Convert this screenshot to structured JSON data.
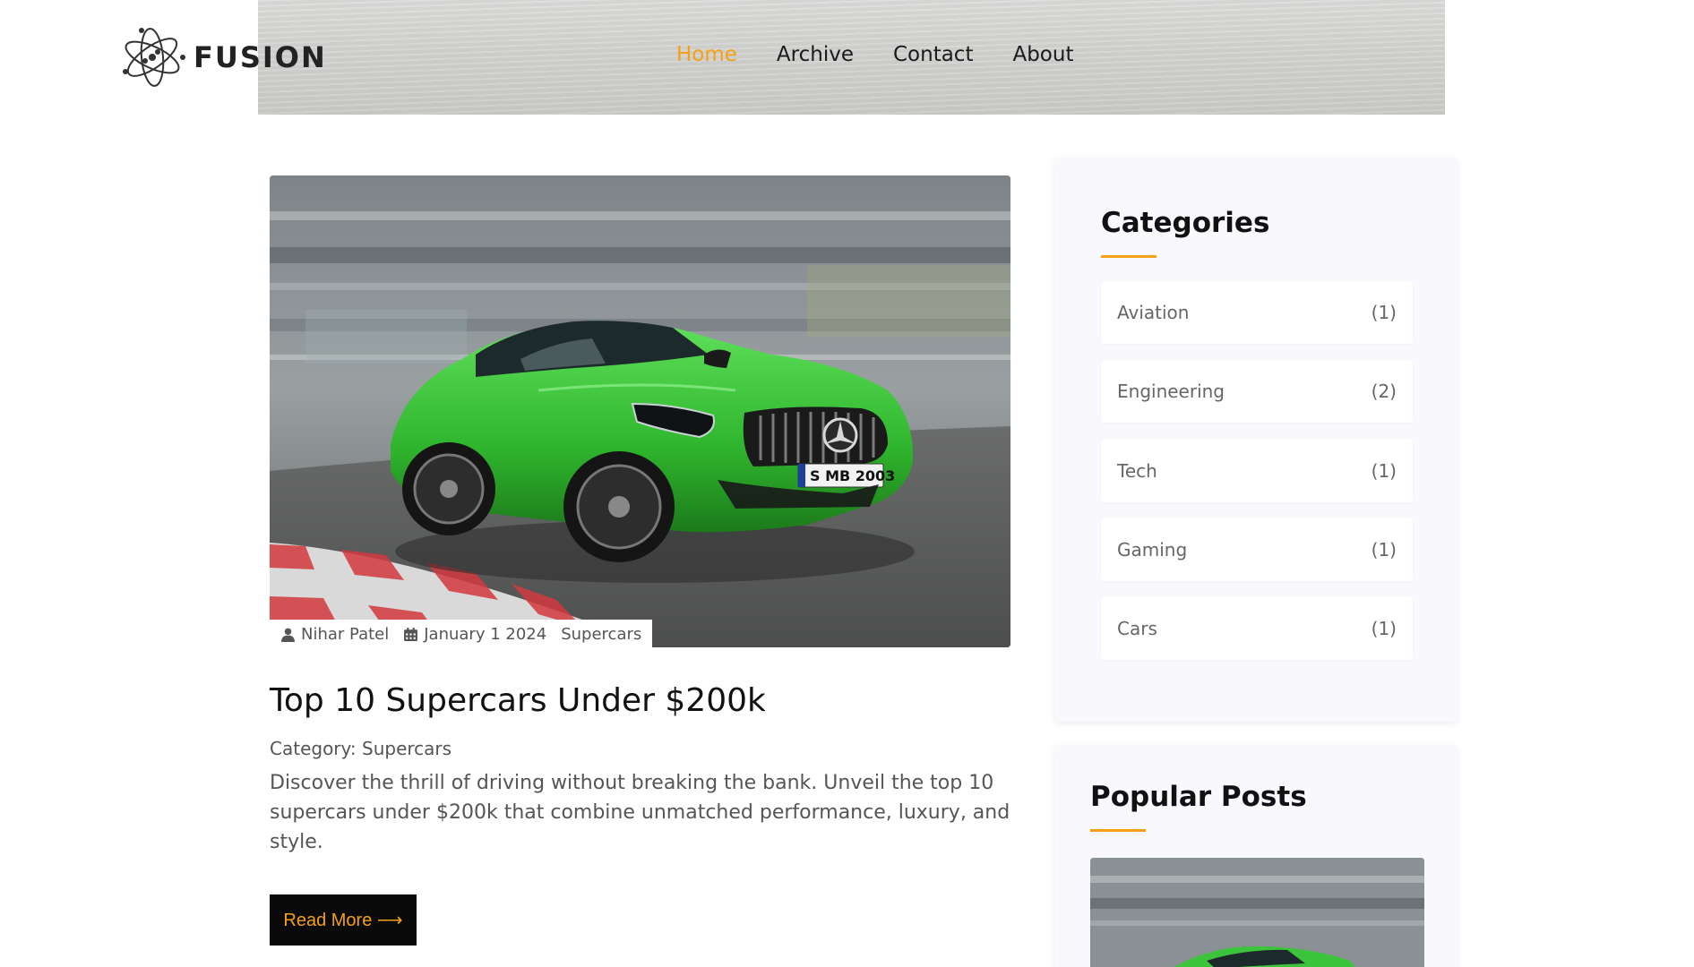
{
  "brand": {
    "name": "FUSION"
  },
  "nav": {
    "items": [
      {
        "label": "Home",
        "active": true
      },
      {
        "label": "Archive",
        "active": false
      },
      {
        "label": "Contact",
        "active": false
      },
      {
        "label": "About",
        "active": false
      }
    ]
  },
  "post": {
    "author": "Nihar Patel",
    "date": "January 1 2024",
    "tag": "Supercars",
    "title": "Top 10 Supercars Under $200k",
    "category_line": "Category: Supercars",
    "excerpt": "Discover the thrill of driving without breaking the bank. Unveil the top 10 supercars under $200k that combine unmatched performance, luxury, and style.",
    "read_more": "Read More ⟶",
    "plate": "S MB 2003"
  },
  "sidebar": {
    "categories_title": "Categories",
    "categories": [
      {
        "name": "Aviation",
        "count": "(1)"
      },
      {
        "name": "Engineering",
        "count": "(2)"
      },
      {
        "name": "Tech",
        "count": "(1)"
      },
      {
        "name": "Gaming",
        "count": "(1)"
      },
      {
        "name": "Cars",
        "count": "(1)"
      }
    ],
    "popular_title": "Popular Posts"
  },
  "colors": {
    "accent": "#f5a015",
    "car_green": "#3cc43a",
    "button_bg": "#0a0a0a",
    "card_bg": "#f9f8fd"
  },
  "icons": {
    "author": "user-icon",
    "date": "calendar-icon",
    "logo": "atom-logo-icon"
  }
}
